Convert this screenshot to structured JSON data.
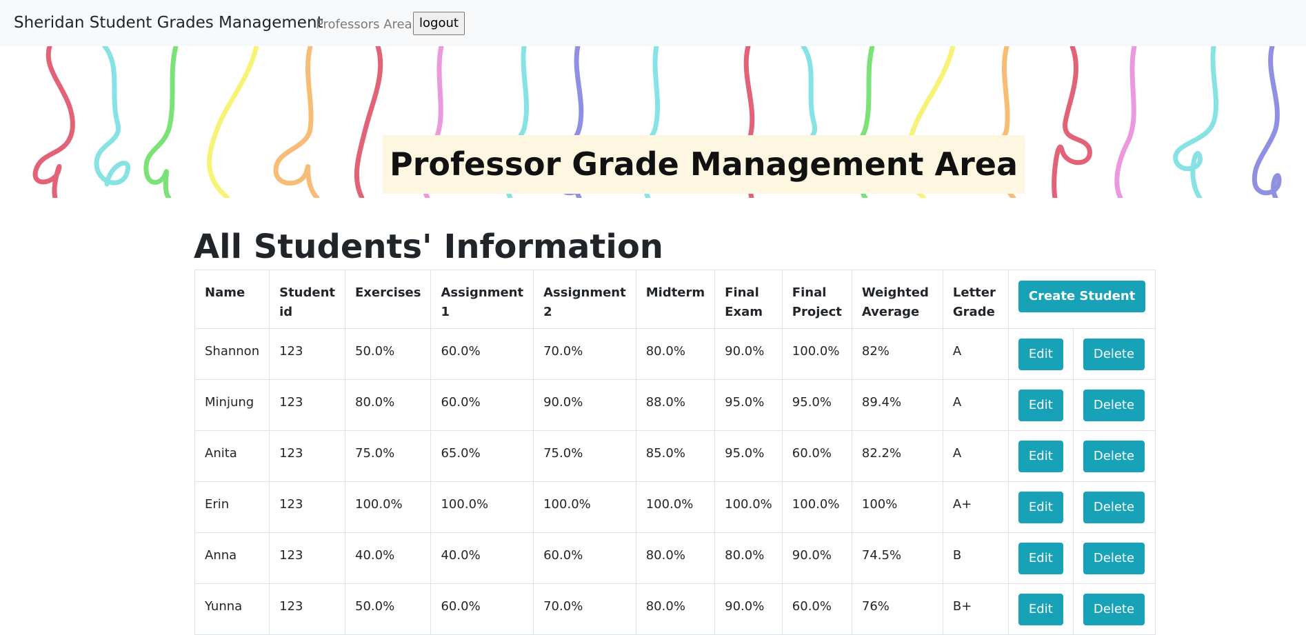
{
  "navbar": {
    "brand": "Sheridan Student Grades Management",
    "professors_area": "Professors Area",
    "logout_label": "logout"
  },
  "banner": {
    "title": "Professor Grade Management Area"
  },
  "section": {
    "title": "All Students' Information"
  },
  "table": {
    "headers": {
      "name": "Name",
      "student_id_1": "Student",
      "student_id_2": "id",
      "exercises": "Exercises",
      "assignment1_1": "Assignment",
      "assignment1_2": "1",
      "assignment2_1": "Assignment",
      "assignment2_2": "2",
      "midterm": "Midterm",
      "final_exam_1": "Final",
      "final_exam_2": "Exam",
      "final_project_1": "Final",
      "final_project_2": "Project",
      "weighted_1": "Weighted",
      "weighted_2": "Average",
      "letter_1": "Letter",
      "letter_2": "Grade"
    },
    "create_label": "Create Student",
    "edit_label": "Edit",
    "delete_label": "Delete",
    "rows": [
      {
        "name": "Shannon",
        "id": "123",
        "exercises": "50.0%",
        "assignment1": "60.0%",
        "assignment2": "70.0%",
        "midterm": "80.0%",
        "final_exam": "90.0%",
        "final_project": "100.0%",
        "weighted": "82%",
        "letter": "A"
      },
      {
        "name": "Minjung",
        "id": "123",
        "exercises": "80.0%",
        "assignment1": "60.0%",
        "assignment2": "90.0%",
        "midterm": "88.0%",
        "final_exam": "95.0%",
        "final_project": "95.0%",
        "weighted": "89.4%",
        "letter": "A"
      },
      {
        "name": "Anita",
        "id": "123",
        "exercises": "75.0%",
        "assignment1": "65.0%",
        "assignment2": "75.0%",
        "midterm": "85.0%",
        "final_exam": "95.0%",
        "final_project": "60.0%",
        "weighted": "82.2%",
        "letter": "A"
      },
      {
        "name": "Erin",
        "id": "123",
        "exercises": "100.0%",
        "assignment1": "100.0%",
        "assignment2": "100.0%",
        "midterm": "100.0%",
        "final_exam": "100.0%",
        "final_project": "100.0%",
        "weighted": "100%",
        "letter": "A+"
      },
      {
        "name": "Anna",
        "id": "123",
        "exercises": "40.0%",
        "assignment1": "40.0%",
        "assignment2": "60.0%",
        "midterm": "80.0%",
        "final_exam": "80.0%",
        "final_project": "90.0%",
        "weighted": "74.5%",
        "letter": "B"
      },
      {
        "name": "Yunna",
        "id": "123",
        "exercises": "50.0%",
        "assignment1": "60.0%",
        "assignment2": "70.0%",
        "midterm": "80.0%",
        "final_exam": "90.0%",
        "final_project": "60.0%",
        "weighted": "76%",
        "letter": "B+"
      }
    ]
  },
  "colors": {
    "navbar_bg": "#f8f9fa",
    "button_info": "#17a2b8",
    "banner_title_bg": "#fdf6e1",
    "squiggle_colors": [
      "#d9304a",
      "#5fd9dc",
      "#4fd94a",
      "#f4ef4a",
      "#f5a647",
      "#e676d4",
      "#6b6bd9"
    ]
  }
}
